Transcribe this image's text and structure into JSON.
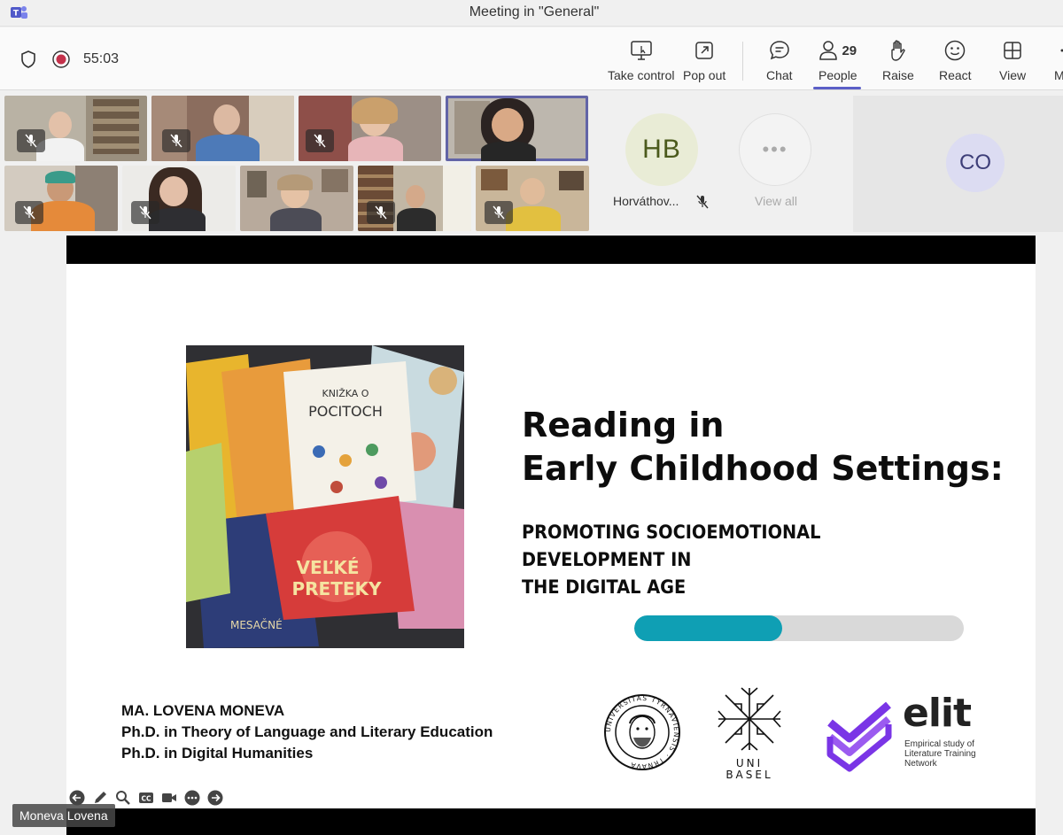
{
  "window": {
    "title": "Meeting in \"General\""
  },
  "toolbar": {
    "timer": "55:03",
    "buttons": {
      "take_control": "Take control",
      "pop_out": "Pop out",
      "chat": "Chat",
      "people": "People",
      "people_count": "29",
      "raise": "Raise",
      "react": "React",
      "view": "View",
      "more": "M"
    }
  },
  "participants": {
    "hb": {
      "initials": "HB",
      "name": "Horváthov..."
    },
    "view_all": "View all",
    "co": {
      "initials": "CO"
    }
  },
  "slide": {
    "title_line1": "Reading in",
    "title_line2": "Early Childhood Settings:",
    "subtitle_line1": "PROMOTING SOCIOEMOTIONAL DEVELOPMENT IN",
    "subtitle_line2": "THE DIGITAL AGE",
    "progress": 0.45,
    "author_line1": "MA. LOVENA MONEVA",
    "author_line2": "Ph.D. in Theory of Language and Literary Education",
    "author_line3": "Ph.D. in Digital Humanities",
    "uni_basel_line1": "UNI",
    "uni_basel_line2": "BASEL",
    "elit_word": "elit",
    "elit_sub": "Empirical study of Literature Training Network",
    "seal_text": "UNIVERSITAS TYRNAVIENSIS · TRNAVA"
  },
  "presenter": {
    "name": "Moneva Lovena"
  },
  "colors": {
    "accent": "#5b5fc7",
    "record": "#c4314b",
    "progress": "#0f9fb4",
    "elit_purple": "#7a35e6"
  }
}
